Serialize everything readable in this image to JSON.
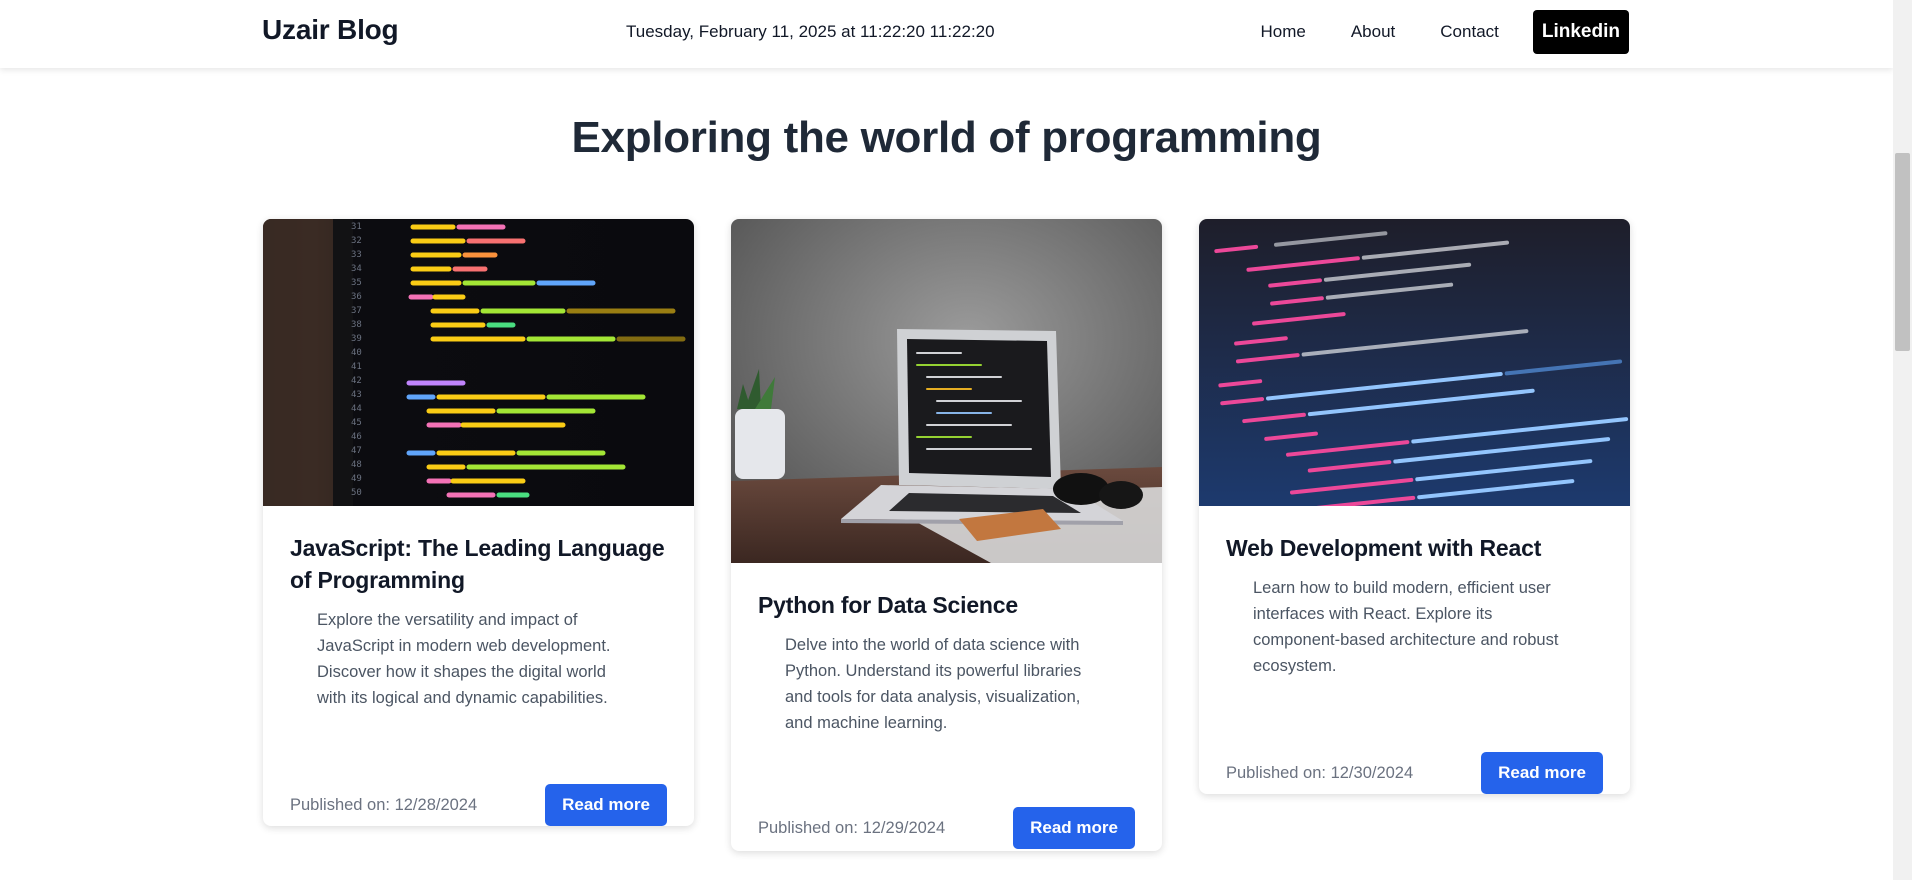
{
  "header": {
    "brand": "Uzair Blog",
    "datetime": "Tuesday, February 11, 2025 at 11:22:20 11:22:20",
    "nav": {
      "home": "Home",
      "about": "About",
      "contact": "Contact",
      "linkedin": "Linkedin"
    }
  },
  "hero": {
    "title": "Exploring the world of programming"
  },
  "cards": [
    {
      "title": "JavaScript: The Leading Language of Programming",
      "description": "Explore the versatility and impact of JavaScript in modern web development. Discover how it shapes the digital world with its logical and dynamic capabilities.",
      "published": "Published on: 12/28/2024",
      "cta": "Read more",
      "image_icon": "code-editor-image"
    },
    {
      "title": "Python for Data Science",
      "description": "Delve into the world of data science with Python. Understand its powerful libraries and tools for data analysis, visualization, and machine learning.",
      "published": "Published on: 12/29/2024",
      "cta": "Read more",
      "image_icon": "laptop-desk-image"
    },
    {
      "title": "Web Development with React",
      "description": "Learn how to build modern, efficient user interfaces with React. Explore its component-based architecture and robust ecosystem.",
      "published": "Published on: 12/30/2024",
      "cta": "Read more",
      "image_icon": "html-code-image"
    }
  ],
  "colors": {
    "primary_button": "#2563eb",
    "linkedin_button": "#000000",
    "heading": "#1f2937"
  }
}
